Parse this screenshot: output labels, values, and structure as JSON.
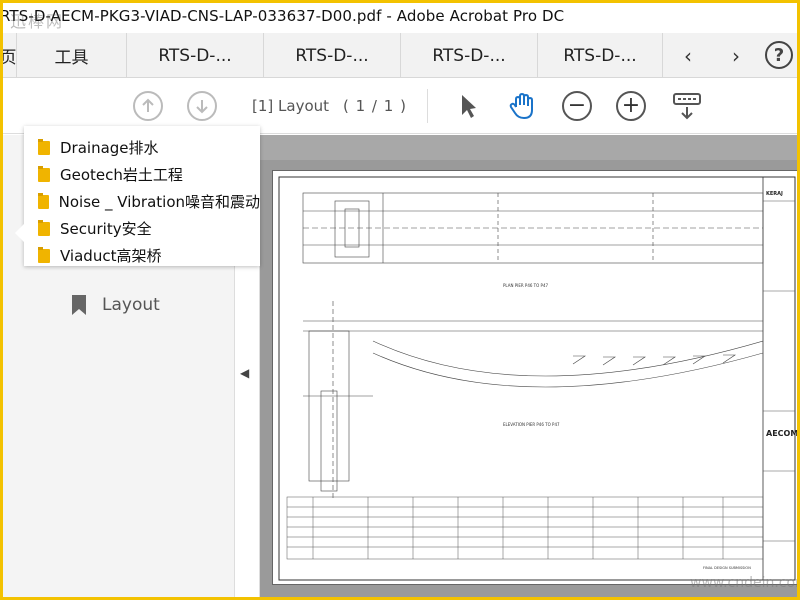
{
  "window": {
    "title": "RTS-D-AECM-PKG3-VIAD-CNS-LAP-033637-D00.pdf - Adobe Acrobat Pro DC",
    "watermark": "迅棒网",
    "watermark_bottom": "www.cndein.com"
  },
  "tabs": {
    "home_label": "页",
    "tools_label": "工具",
    "documents": [
      "RTS-D-...",
      "RTS-D-...",
      "RTS-D-...",
      "RTS-D-..."
    ],
    "prev_icon": "chevron-left-icon",
    "next_icon": "chevron-right-icon",
    "help_label": "?"
  },
  "toolbar": {
    "page_label": "[1] Layout",
    "page_count": "( 1 / 1 )"
  },
  "bookmarks": {
    "folders": [
      "Drainage排水",
      "Geotech岩土工程",
      "Noise _ Vibration噪音和震动",
      "Security安全",
      "Viaduct高架桥"
    ],
    "layout_label": "Layout"
  },
  "drawing": {
    "plan_title": "PLAN PIER P46 TO P47",
    "elevation_title": "ELEVATION PIER P46 TO P47",
    "stamp": "FINAL DESIGN SUBMISSION",
    "company": "AECOM",
    "client_header": "KERAJ"
  }
}
